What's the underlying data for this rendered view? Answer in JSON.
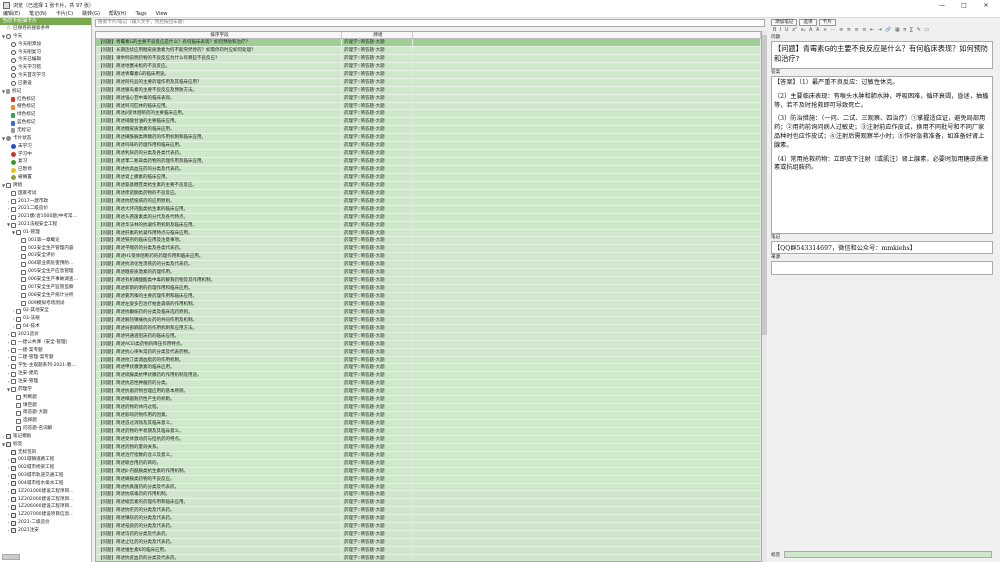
{
  "window": {
    "title": "浏览（已选择 1 张卡片，共 97 张）",
    "controls": [
      "—",
      "□",
      "✕"
    ]
  },
  "menu": [
    "编辑(E)",
    "笔记(N)",
    "卡片(C)",
    "跳转(G)",
    "帮助(H)",
    "Tags",
    "View"
  ],
  "sidebar": {
    "header": "当前卡组抽卡片",
    "bottom_label": "",
    "items": [
      {
        "label": "已保存的搜索条件",
        "icon": "star",
        "depth": 0,
        "arrow": ""
      },
      {
        "label": "今天",
        "icon": "clock",
        "depth": 0,
        "arrow": "▼"
      },
      {
        "label": "今天刚添加",
        "icon": "clock",
        "depth": 1,
        "arrow": ""
      },
      {
        "label": "今天刚复习",
        "icon": "clock",
        "depth": 1,
        "arrow": ""
      },
      {
        "label": "今天已编辑",
        "icon": "clock",
        "depth": 1,
        "arrow": ""
      },
      {
        "label": "今天学习错",
        "icon": "clock",
        "depth": 1,
        "arrow": ""
      },
      {
        "label": "今天首次学习",
        "icon": "clock",
        "depth": 1,
        "arrow": ""
      },
      {
        "label": "已重设",
        "icon": "clock",
        "depth": 1,
        "arrow": ""
      },
      {
        "label": "标记",
        "icon": "flag-grey",
        "depth": 0,
        "arrow": "▼"
      },
      {
        "label": "红色标记",
        "icon": "flag-red",
        "depth": 1,
        "arrow": ""
      },
      {
        "label": "橙色标记",
        "icon": "flag-orange",
        "depth": 1,
        "arrow": ""
      },
      {
        "label": "绿色标记",
        "icon": "flag-green",
        "depth": 1,
        "arrow": ""
      },
      {
        "label": "蓝色标记",
        "icon": "flag-blue",
        "depth": 1,
        "arrow": ""
      },
      {
        "label": "无标记",
        "icon": "flag-grey",
        "depth": 1,
        "arrow": ""
      },
      {
        "label": "卡片状态",
        "icon": "dot-grey",
        "depth": 0,
        "arrow": "▼"
      },
      {
        "label": "未学习",
        "icon": "dot-blue",
        "depth": 1,
        "arrow": ""
      },
      {
        "label": "学习中",
        "icon": "dot-red",
        "depth": 1,
        "arrow": ""
      },
      {
        "label": "复习",
        "icon": "dot-green",
        "depth": 1,
        "arrow": ""
      },
      {
        "label": "已暂停",
        "icon": "dot-yellow",
        "depth": 1,
        "arrow": ""
      },
      {
        "label": "被搁置",
        "icon": "dot-olive",
        "depth": 1,
        "arrow": ""
      },
      {
        "label": "牌组",
        "icon": "deck",
        "depth": 0,
        "arrow": "▼"
      },
      {
        "label": "国家考试",
        "icon": "deck",
        "depth": 1,
        "arrow": ""
      },
      {
        "label": "2017一建市政",
        "icon": "deck",
        "depth": 1,
        "arrow": "›"
      },
      {
        "label": "2021二级造价",
        "icon": "deck",
        "depth": 1,
        "arrow": "›"
      },
      {
        "label": "2021版(含1000题)中考常…",
        "icon": "deck",
        "depth": 1,
        "arrow": "›"
      },
      {
        "label": "2021法规安全工程",
        "icon": "deck",
        "depth": 1,
        "arrow": "▼"
      },
      {
        "label": "01-管理",
        "icon": "deck",
        "depth": 2,
        "arrow": "▼"
      },
      {
        "label": "001第一章概论",
        "icon": "deck",
        "depth": 3,
        "arrow": ""
      },
      {
        "label": "002安全生产管理内容",
        "icon": "deck",
        "depth": 3,
        "arrow": ""
      },
      {
        "label": "003安全评价",
        "icon": "deck",
        "depth": 3,
        "arrow": ""
      },
      {
        "label": "004职业病危害预防…",
        "icon": "deck",
        "depth": 3,
        "arrow": ""
      },
      {
        "label": "005安全生产应急管理",
        "icon": "deck",
        "depth": 3,
        "arrow": ""
      },
      {
        "label": "006安全生产事故调查…",
        "icon": "deck",
        "depth": 3,
        "arrow": ""
      },
      {
        "label": "007安全生产监管监察",
        "icon": "deck",
        "depth": 3,
        "arrow": ""
      },
      {
        "label": "008安全生产统计分析",
        "icon": "deck",
        "depth": 3,
        "arrow": ""
      },
      {
        "label": "009模拟考场测试",
        "icon": "deck",
        "depth": 3,
        "arrow": ""
      },
      {
        "label": "02-其他安全",
        "icon": "deck",
        "depth": 2,
        "arrow": "›"
      },
      {
        "label": "03-法规",
        "icon": "deck",
        "depth": 2,
        "arrow": "›"
      },
      {
        "label": "04-技术",
        "icon": "deck",
        "depth": 2,
        "arrow": "›"
      },
      {
        "label": "2021造价",
        "icon": "deck",
        "depth": 1,
        "arrow": "›"
      },
      {
        "label": "一建公共课（安全-管理）",
        "icon": "deck",
        "depth": 1,
        "arrow": "›"
      },
      {
        "label": "一建-案专题",
        "icon": "deck",
        "depth": 1,
        "arrow": "›"
      },
      {
        "label": "二建-管理-案专题",
        "icon": "deck",
        "depth": 1,
        "arrow": "›"
      },
      {
        "label": "学生-主观题系列-2021-教…",
        "icon": "deck",
        "depth": 1,
        "arrow": "›"
      },
      {
        "label": "注安-建筑",
        "icon": "deck",
        "depth": 1,
        "arrow": "›"
      },
      {
        "label": "注安-管理",
        "icon": "deck",
        "depth": 1,
        "arrow": "›"
      },
      {
        "label": "药理学",
        "icon": "deck",
        "depth": 1,
        "arrow": "▼"
      },
      {
        "label": "判断题",
        "icon": "deck",
        "depth": 2,
        "arrow": ""
      },
      {
        "label": "填空题",
        "icon": "deck",
        "depth": 2,
        "arrow": ""
      },
      {
        "label": "简答题-大题",
        "icon": "deck",
        "depth": 2,
        "arrow": ""
      },
      {
        "label": "选择题",
        "icon": "deck",
        "depth": 2,
        "arrow": ""
      },
      {
        "label": "问答题-名词解",
        "icon": "deck",
        "depth": 2,
        "arrow": ""
      },
      {
        "label": "笔记模板",
        "icon": "box",
        "depth": 0,
        "arrow": "›"
      },
      {
        "label": "标签",
        "icon": "box",
        "depth": 0,
        "arrow": "▼"
      },
      {
        "label": "无标签的",
        "icon": "box",
        "depth": 1,
        "arrow": ""
      },
      {
        "label": "001城镇道路工程",
        "icon": "box",
        "depth": 1,
        "arrow": "›"
      },
      {
        "label": "002城市桥梁工程",
        "icon": "box",
        "depth": 1,
        "arrow": "›"
      },
      {
        "label": "003城市轨道交通工程",
        "icon": "box",
        "depth": 1,
        "arrow": "›"
      },
      {
        "label": "004城市给水排水工程",
        "icon": "box",
        "depth": 1,
        "arrow": "›"
      },
      {
        "label": "1Z201000建设工程项目…",
        "icon": "box",
        "depth": 1,
        "arrow": "›"
      },
      {
        "label": "1Z202000建设工程项目…",
        "icon": "box",
        "depth": 1,
        "arrow": "›"
      },
      {
        "label": "1Z206000建设工程项目…",
        "icon": "box",
        "depth": 1,
        "arrow": "›"
      },
      {
        "label": "1Z207000建设项目信息…",
        "icon": "box",
        "depth": 1,
        "arrow": "›"
      },
      {
        "label": "2021-二级造价",
        "icon": "box",
        "depth": 1,
        "arrow": "›"
      },
      {
        "label": "2021注安",
        "icon": "box",
        "depth": 1,
        "arrow": "›"
      }
    ]
  },
  "browser": {
    "search_placeholder": "搜索卡片/笔记（输入文字，然后按回车键）",
    "columns": [
      "排序字段",
      "牌组",
      ""
    ],
    "rows": [
      [
        "【问题】青霉素G的主要不良反应是什么？有何临床表现？如何预防和治疗?",
        "药理学::简答题-大题"
      ],
      [
        "【问题】长期连续应用糖皮质激素为何不能突然停药？如需停药时应如何处理?",
        "药理学::简答题-大题"
      ],
      [
        "【问题】请举例说明药物的不良反应为什么有哪些不良反应?",
        "药理学::简答题-大题"
      ],
      [
        "【问题】简述地塞米松的不良反应。",
        "药理学::简答题-大题"
      ],
      [
        "【问题】简述青霉素G的临床用途。",
        "药理学::简答题-大题"
      ],
      [
        "【问题】简述阿托品的主要药理作用及其临床应用?",
        "药理学::简答题-大题"
      ],
      [
        "【问题】简述胰岛素的主要不良反应及预防方法。",
        "药理学::简答题-大题"
      ],
      [
        "【问题】简述强心苷中毒的临床表现。",
        "药理学::简答题-大题"
      ],
      [
        "【问题】简述阿司匹林的临床应用。",
        "药理学::简答题-大题"
      ],
      [
        "【问题】简述β受体阻断药的主要临床应用。",
        "药理学::简答题-大题"
      ],
      [
        "【问题】简述硝酸甘油的主要临床应用。",
        "药理学::简答题-大题"
      ],
      [
        "【问题】简述糖皮质激素的临床应用。",
        "药理学::简答题-大题"
      ],
      [
        "【问题】简述磺酰脲类降糖药的作用机制和临床应用。",
        "药理学::简答题-大题"
      ],
      [
        "【问题】简述吗啡的药理作用和临床应用。",
        "药理学::简答题-大题"
      ],
      [
        "【问题】简述利尿药的分类及各类代表药。",
        "药理学::简答题-大题"
      ],
      [
        "【问题】简述苯二氮䓬类药物的药理作用及临床应用。",
        "药理学::简答题-大题"
      ],
      [
        "【问题】简述抗高血压药的分类及代表药。",
        "药理学::简答题-大题"
      ],
      [
        "【问题】简述肾上腺素的临床应用。",
        "药理学::简答题-大题"
      ],
      [
        "【问题】简述氨基糖苷类抗生素的主要不良反应。",
        "药理学::简答题-大题"
      ],
      [
        "【问题】简述喹诺酮类药物的不良反应。",
        "药理学::简答题-大题"
      ],
      [
        "【问题】简述抗结核病药的应用原则。",
        "药理学::简答题-大题"
      ],
      [
        "【问题】简述大环内酯类抗生素的临床应用。",
        "药理学::简答题-大题"
      ],
      [
        "【问题】简述头孢菌素类的分代及各代特点。",
        "药理学::简答题-大题"
      ],
      [
        "【问题】简述华法林的抗凝作用机制及临床应用。",
        "药理学::简答题-大题"
      ],
      [
        "【问题】简述肝素的抗凝作用特点与临床应用。",
        "药理学::简答题-大题"
      ],
      [
        "【问题】简述铁剂的临床应用及注意事项。",
        "药理学::简答题-大题"
      ],
      [
        "【问题】简述平喘药的分类及各类代表药。",
        "药理学::简答题-大题"
      ],
      [
        "【问题】简述H1受体阻断药的药理作用和临床应用。",
        "药理学::简答题-大题"
      ],
      [
        "【问题】简述抗消化性溃疡药的分类及代表药。",
        "药理学::简答题-大题"
      ],
      [
        "【问题】简述糖皮质激素的药理作用。",
        "药理学::简答题-大题"
      ],
      [
        "【问题】简述有机磷酸酯类中毒的解救药物及其作用机制。",
        "药理学::简答题-大题"
      ],
      [
        "【问题】简述新斯的明的药理作用和临床应用。",
        "药理学::简答题-大题"
      ],
      [
        "【问题】简述氯丙嗪的主要药理作用和临床应用。",
        "药理学::简答题-大题"
      ],
      [
        "【问题】简述左旋多巴治疗帕金森病的作用机制。",
        "药理学::简答题-大题"
      ],
      [
        "【问题】简述抗癫痫药的分类及临床选药原则。",
        "药理学::简答题-大题"
      ],
      [
        "【问题】简述解热镇痛抗炎药的共同作用及机制。",
        "药理学::简答题-大题"
      ],
      [
        "【问题】简述局部麻醉药的作用机制和应用方法。",
        "药理学::简答题-大题"
      ],
      [
        "【问题】简述钙通道阻滞药的临床应用。",
        "药理学::简答题-大题"
      ],
      [
        "【问题】简述ACEI类药物的降压作用特点。",
        "药理学::简答题-大题"
      ],
      [
        "【问题】简述抗心律失常药的分类及代表药物。",
        "药理学::简答题-大题"
      ],
      [
        "【问题】简述他汀类调血脂药的作用机制。",
        "药理学::简答题-大题"
      ],
      [
        "【问题】简述甲状腺激素的临床应用。",
        "药理学::简答题-大题"
      ],
      [
        "【问题】简述硫脲类抗甲状腺药的作用机制及用途。",
        "药理学::简答题-大题"
      ],
      [
        "【问题】简述抗恶性肿瘤药的分类。",
        "药理学::简答题-大题"
      ],
      [
        "【问题】简述抗菌药物合理应用的基本原则。",
        "药理学::简答题-大题"
      ],
      [
        "【问题】简述细菌耐药性产生的机制。",
        "药理学::简答题-大题"
      ],
      [
        "【问题】简述药物的体内过程。",
        "药理学::简答题-大题"
      ],
      [
        "【问题】简述影响药物作用的因素。",
        "药理学::简答题-大题"
      ],
      [
        "【问题】简述首过消除及其临床意义。",
        "药理学::简答题-大题"
      ],
      [
        "【问题】简述药物的半衰期及其临床意义。",
        "药理学::简答题-大题"
      ],
      [
        "【问题】简述受体激动药与拮抗药的特点。",
        "药理学::简答题-大题"
      ],
      [
        "【问题】简述药物的量效关系。",
        "药理学::简答题-大题"
      ],
      [
        "【问题】简述治疗指数的含义及意义。",
        "药理学::简答题-大题"
      ],
      [
        "【问题】简述联合用药的目的。",
        "药理学::简答题-大题"
      ],
      [
        "【问题】简述β-内酰胺类抗生素的作用机制。",
        "药理学::简答题-大题"
      ],
      [
        "【问题】简述磺胺类药物的不良反应。",
        "药理学::简答题-大题"
      ],
      [
        "【问题】简述抗真菌药的分类及代表药。",
        "药理学::简答题-大题"
      ],
      [
        "【问题】简述抗病毒药的作用机制。",
        "药理学::简答题-大题"
      ],
      [
        "【问题】简述缩宫素的药理作用和临床应用。",
        "药理学::简答题-大题"
      ],
      [
        "【问题】简述抗疟药的分类及代表药。",
        "药理学::简答题-大题"
      ],
      [
        "【问题】简述镇咳药的分类及代表药。",
        "药理学::简答题-大题"
      ],
      [
        "【问题】简述祛痰药的分类及代表药。",
        "药理学::简答题-大题"
      ],
      [
        "【问题】简述泻药的分类及代表药。",
        "药理学::简答题-大题"
      ],
      [
        "【问题】简述止吐药的分类及代表药。",
        "药理学::简答题-大题"
      ],
      [
        "【问题】简述维生素K的临床应用。",
        "药理学::简答题-大题"
      ],
      [
        "【问题】简述抗贫血药的分类及代表药。",
        "药理学::简答题-大题"
      ],
      [
        "【问题】简述胰岛素的临床应用。",
        "药理学::简答题-大题"
      ]
    ]
  },
  "editor": {
    "buttons": [
      "添加笔记",
      "选项",
      "卡片"
    ],
    "format_icons": [
      "B",
      "I",
      "U",
      "x²",
      "x₂",
      "A",
      "A",
      "⨯",
      "⋯",
      "≡",
      "≡",
      "≡",
      "≡",
      "⇤",
      "⇥",
      "🔗",
      "▦",
      "π",
      "∑",
      "✎",
      "▭"
    ],
    "question_label": "问题",
    "question_text": "【问题】青霉素G的主要不良反应是什么？有何临床表现？如何预防和治疗?",
    "answer_label": "答案",
    "answer_paragraphs": [
      "【答案】（1）最严重不良反应：过敏性休克。",
      "（2）主要临床表现：有喉头水肿和肺水肿，呼吸困难，循环衰竭，昏迷，抽搐等，若不及时抢救即可导致死亡。",
      "（3）防治措施：（一问、二试、三观察、四治疗）①掌握适应证，避免局部用药；②用药前询问病人过敏史；③注射前应作皮试，换用不同批号和不同厂家品种时也应作皮试；④注射后需观察半小时；⑤作好急救准备，如准备好肾上腺素。",
      "（4）常用抢救药物：立即皮下注射（或肌注）肾上腺素，必要时加用糖皮质激素或抗组胺药。"
    ],
    "note_label": "笔记",
    "note_text": "【QQ群543314697，微信和公众号：mmkiehs】",
    "source_label": "来源",
    "source_text": "",
    "tags_label": "标签"
  },
  "colors": {
    "row": "#cfe8cb",
    "row_selected": "#9fcf97",
    "header": "#79a84f"
  }
}
